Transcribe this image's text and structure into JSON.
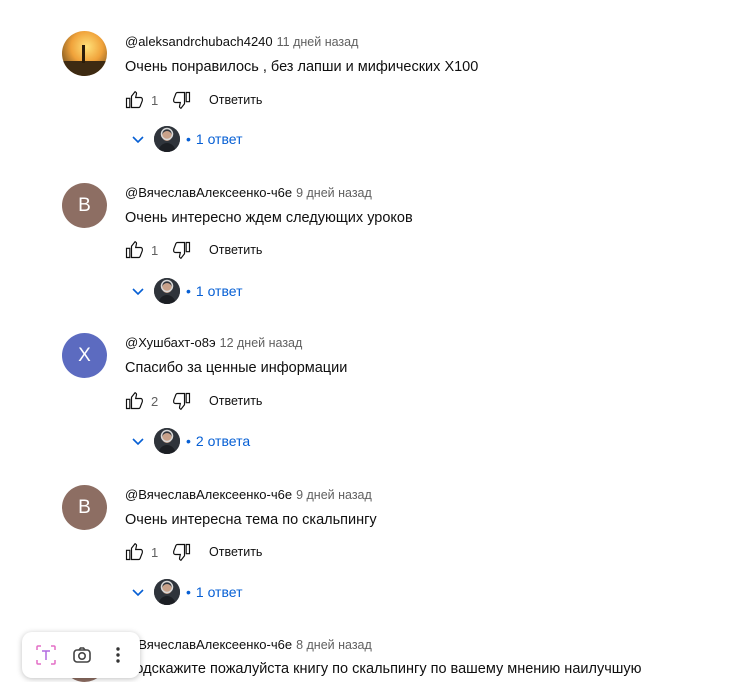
{
  "comments": [
    {
      "author": "@aleksandrchubach4240",
      "time": "11 дней назад",
      "text": "Очень понравилось , без лапши и мифических X100",
      "likes": "1",
      "reply_label": "Ответить",
      "replies_label": "1 ответ",
      "avatar_type": "photo"
    },
    {
      "author": "@ВячеславАлексеенко-ч6е",
      "time": "9 дней назад",
      "text": "Очень интересно ждем следующих уроков",
      "likes": "1",
      "reply_label": "Ответить",
      "replies_label": "1 ответ",
      "avatar_letter": "В"
    },
    {
      "author": "@Хушбахт-о8э",
      "time": "12 дней назад",
      "text": "Спасибо за ценные информации",
      "likes": "2",
      "reply_label": "Ответить",
      "replies_label": "2 ответа",
      "avatar_letter": "Х"
    },
    {
      "author": "@ВячеславАлексеенко-ч6е",
      "time": "9 дней назад",
      "text": "Очень интересна тема по скальпингу",
      "likes": "1",
      "reply_label": "Ответить",
      "replies_label": "1 ответ",
      "avatar_letter": "В"
    },
    {
      "author": "@ВячеславАлексеенко-ч6е",
      "time": "8 дней назад",
      "text": "Подскажите пожалуйста  книгу по скальпингу по вашему мнению наилучшую",
      "avatar_letter": "В"
    }
  ],
  "colors": {
    "link_blue": "#065fd4",
    "meta_gray": "#606060",
    "avatar_b": "#8d6e63",
    "avatar_x": "#5c6bc0"
  },
  "icons": {
    "like": "thumbs-up-icon",
    "dislike": "thumbs-down-icon",
    "expand": "chevron-down-icon",
    "toolbar": [
      "text-recognition-icon",
      "lens-search-icon",
      "more-vert-icon"
    ]
  }
}
